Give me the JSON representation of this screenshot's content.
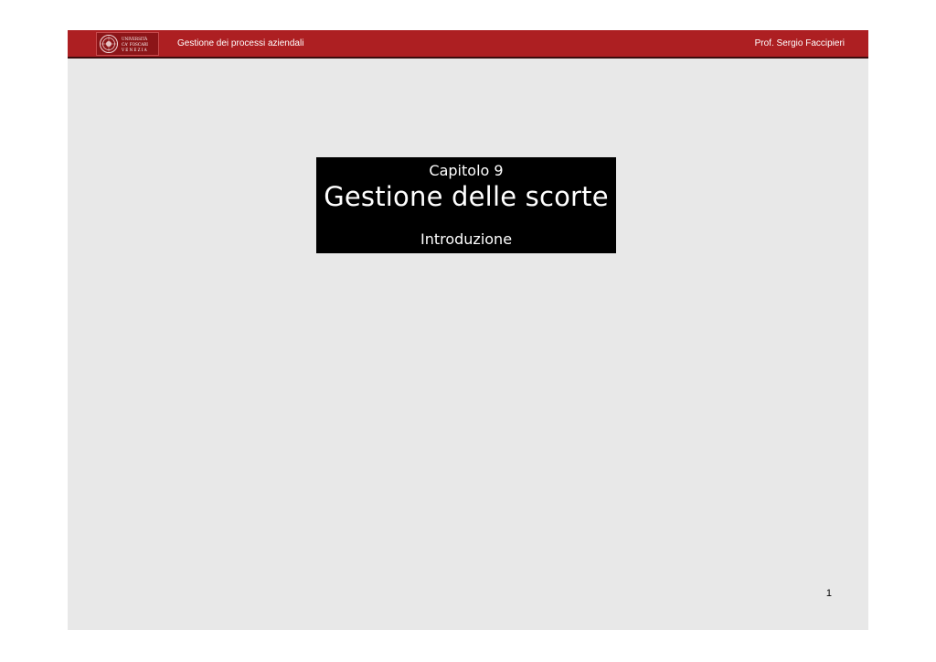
{
  "header": {
    "course_title": "Gestione dei processi aziendali",
    "author": "Prof. Sergio Faccipieri",
    "logo": {
      "line1": "UNIVERSITÀ",
      "line2": "CA' FOSCARI",
      "line3": "VENEZIA"
    }
  },
  "title_box": {
    "chapter": "Capitolo 9",
    "title": "Gestione delle scorte",
    "subtitle": "Introduzione"
  },
  "footer": {
    "page_number": "1"
  },
  "colors": {
    "header_bg": "#ad1f22",
    "slide_bg": "#e8e8e8",
    "title_box_bg": "#000000"
  }
}
